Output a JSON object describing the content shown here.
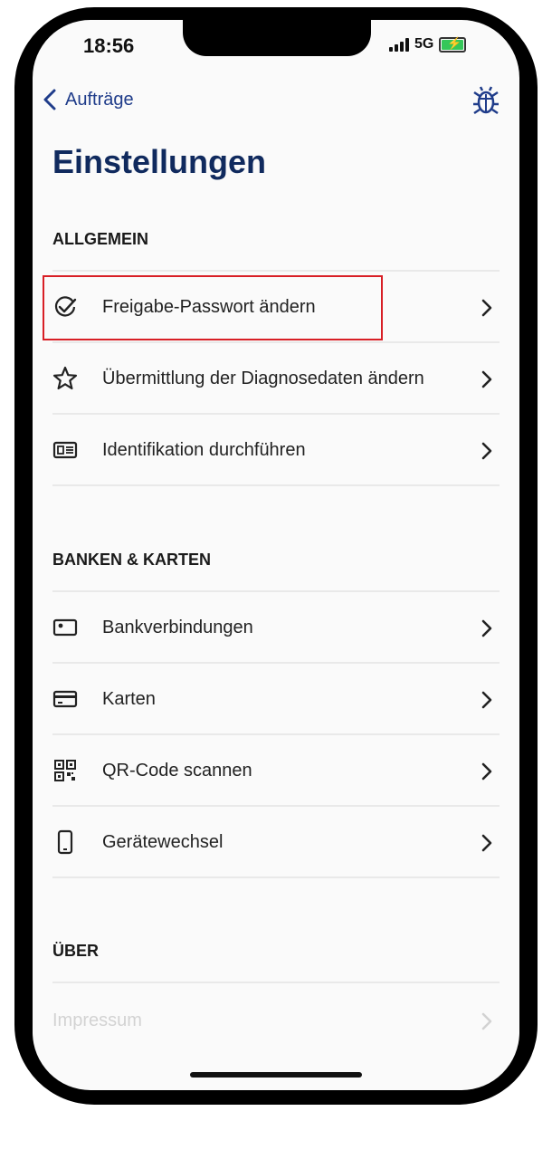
{
  "status_bar": {
    "time": "18:56",
    "network": "5G"
  },
  "nav": {
    "back_label": "Aufträge"
  },
  "page": {
    "title": "Einstellungen"
  },
  "sections": [
    {
      "header": "ALLGEMEIN",
      "items": [
        {
          "label": "Freigabe-Passwort ändern",
          "icon": "check-circle-icon"
        },
        {
          "label": "Übermittlung der Diagnosedaten ändern",
          "icon": "star-icon"
        },
        {
          "label": "Identifikation durchführen",
          "icon": "id-card-icon"
        }
      ]
    },
    {
      "header": "BANKEN & KARTEN",
      "items": [
        {
          "label": "Bankverbindungen",
          "icon": "bank-account-icon"
        },
        {
          "label": "Karten",
          "icon": "credit-card-icon"
        },
        {
          "label": "QR-Code scannen",
          "icon": "qr-code-icon"
        },
        {
          "label": "Gerätewechsel",
          "icon": "phone-device-icon"
        }
      ]
    },
    {
      "header": "ÜBER",
      "items": [
        {
          "label": "Impressum"
        }
      ]
    }
  ],
  "colors": {
    "accent": "#1f3c8a",
    "title": "#102a5e",
    "highlight": "#d81f26"
  }
}
